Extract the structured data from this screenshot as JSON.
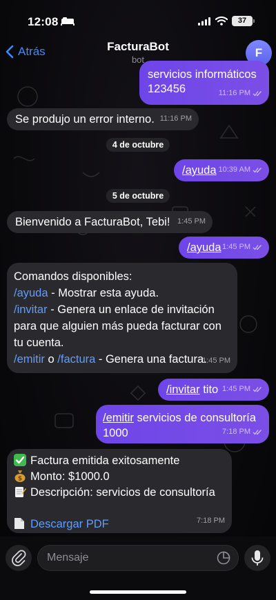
{
  "status_bar": {
    "time": "12:08",
    "battery": "37"
  },
  "header": {
    "back_label": "Atrás",
    "title": "FacturaBot",
    "subtitle": "bot",
    "avatar_letter": "F"
  },
  "messages": {
    "m1": {
      "text": "servicios informáticos\n123456",
      "time": "11:16 PM"
    },
    "m2": {
      "text": "Se produjo un error interno.",
      "time": "11:16 PM"
    },
    "date1": "4 de octubre",
    "m3": {
      "cmd": "/ayuda",
      "time": "10:39 AM"
    },
    "date2": "5 de octubre",
    "m4": {
      "text": "Bienvenido a FacturaBot, Tebi!",
      "time": "1:45 PM"
    },
    "m5": {
      "cmd": "/ayuda",
      "time": "1:45 PM"
    },
    "m6": {
      "heading": "Comandos disponibles:",
      "cmd_ayuda": "/ayuda",
      "desc_ayuda": " - Mostrar esta ayuda.",
      "cmd_invitar": "/invitar",
      "desc_invitar_1": " - Genera un enlace de invitación",
      "desc_invitar_2": "para que alguien más pueda facturar con",
      "desc_invitar_3": "tu cuenta.",
      "cmd_emitir": "/emitir",
      "word_o": " o ",
      "cmd_factura": "/factura",
      "desc_emitir": " - Genera una factura.",
      "time": "1:45 PM"
    },
    "m7": {
      "cmd": "/invitar",
      "arg": " tito",
      "time": "1:45 PM"
    },
    "m8": {
      "cmd": "/emitir",
      "arg_1": " servicios de consultoría",
      "arg_2": "1000",
      "time": "7:18 PM"
    },
    "m9": {
      "line1": "Factura emitida exitosamente",
      "line2": "Monto: $1000.0",
      "line3": "Descripción: servicios de consultoría",
      "link": "Descargar PDF",
      "time": "7:18 PM",
      "icon1": "check-mark-emoji",
      "icon2": "money-bag-emoji",
      "icon3": "memo-emoji",
      "icon4": "document-emoji"
    }
  },
  "composer": {
    "placeholder": "Mensaje"
  },
  "colors": {
    "accent": "#3e8bff",
    "outgoing": "#6e45e8",
    "incoming": "#2a2a2e",
    "link": "#5e9dff"
  }
}
